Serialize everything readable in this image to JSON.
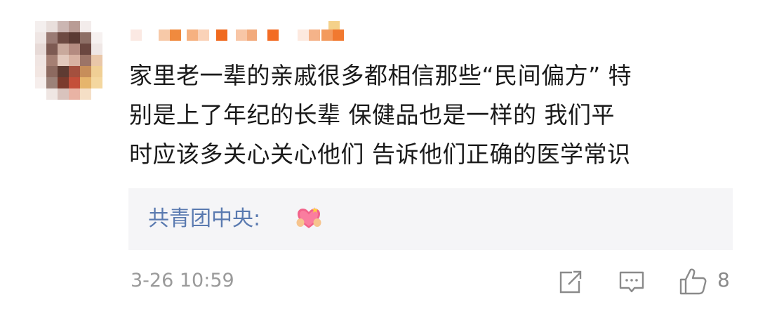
{
  "comment": {
    "avatar": "pixelated-avatar",
    "username_masked": true,
    "text_lines": [
      "家里老一辈的亲戚很多都相信那些“民间偏方” 特",
      "别是上了年纪的长辈  保健品也是一样的  我们平",
      "时应该多关心关心他们 告诉他们正确的医学常识"
    ],
    "reply": {
      "author": "共青团中央:",
      "emoji": "heart-hands-emoji"
    },
    "time": "3-26 10:59",
    "actions": {
      "forward_icon": "share-icon",
      "comment_icon": "comment-icon",
      "like_icon": "thumbs-up-icon",
      "like_count": "8"
    }
  },
  "colors": {
    "text": "#1a1a1a",
    "reply_author": "#5a7ab0",
    "reply_bg": "#f5f5f7",
    "meta": "#9a9a9a"
  }
}
